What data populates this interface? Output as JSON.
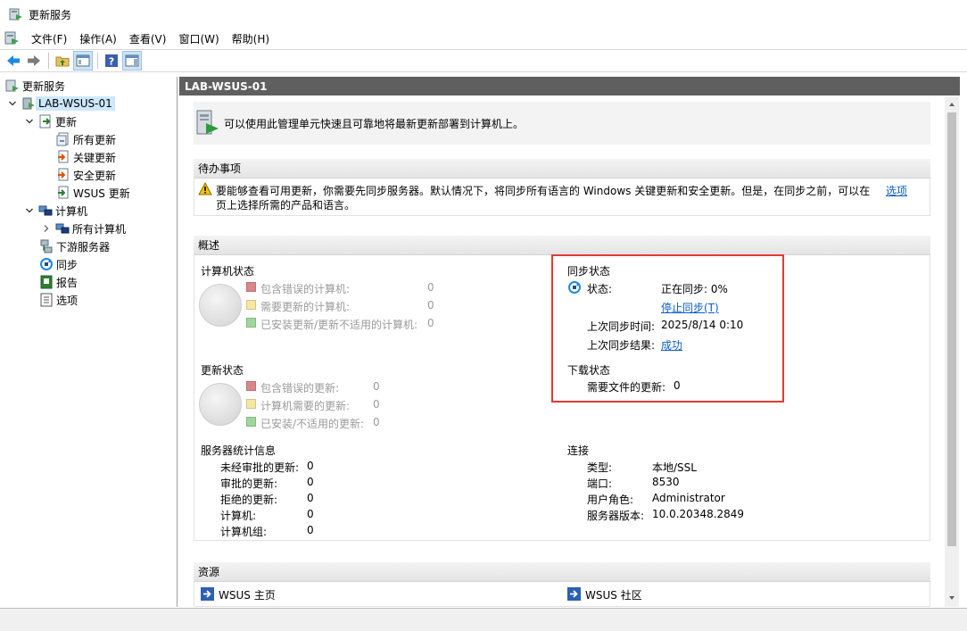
{
  "window": {
    "title": "更新服务"
  },
  "menu": [
    "文件(F)",
    "操作(A)",
    "查看(V)",
    "窗口(W)",
    "帮助(H)"
  ],
  "tree": {
    "root": "更新服务",
    "server": "LAB-WSUS-01",
    "updates": "更新",
    "all_updates": "所有更新",
    "critical_updates": "关键更新",
    "security_updates": "安全更新",
    "wsus_updates": "WSUS 更新",
    "computers": "计算机",
    "all_computers": "所有计算机",
    "downstream": "下游服务器",
    "sync": "同步",
    "reports": "报告",
    "options": "选项"
  },
  "pane": {
    "header": "LAB-WSUS-01",
    "intro": "可以使用此管理单元快速且可靠地将最新更新部署到计算机上。"
  },
  "todo": {
    "title": "待办事项",
    "text1": "要能够查看可用更新，你需要先同步服务器。默认情况下，将同步所有语言的 Windows 关键更新和安全更新。但是，在同步之前，可以在",
    "link": "选项",
    "text2": "页上选择所需的产品和语言。"
  },
  "overview": {
    "title": "概述",
    "computer_status": {
      "title": "计算机状态",
      "rows": [
        {
          "label": "包含错误的计算机:",
          "value": "0",
          "color": "#d9868a"
        },
        {
          "label": "需要更新的计算机:",
          "value": "0",
          "color": "#f6e7a3"
        },
        {
          "label": "已安装更新/更新不适用的计算机:",
          "value": "0",
          "color": "#9fd69b"
        }
      ]
    },
    "update_status": {
      "title": "更新状态",
      "rows": [
        {
          "label": "包含错误的更新:",
          "value": "0",
          "color": "#d9868a"
        },
        {
          "label": "计算机需要的更新:",
          "value": "0",
          "color": "#f6e7a3"
        },
        {
          "label": "已安装/不适用的更新:",
          "value": "0",
          "color": "#9fd69b"
        }
      ]
    },
    "sync_status": {
      "title": "同步状态",
      "status_label": "状态:",
      "status_value": "正在同步: 0%",
      "stop_link": "停止同步(T)",
      "last_sync_label": "上次同步时间:",
      "last_sync_value": "2025/8/14 0:10",
      "last_result_label": "上次同步结果:",
      "last_result_value": "成功"
    },
    "download_status": {
      "title": "下载状态",
      "label": "需要文件的更新:",
      "value": "0"
    },
    "server_stats": {
      "title": "服务器统计信息",
      "rows": [
        {
          "label": "未经审批的更新:",
          "value": "0"
        },
        {
          "label": "审批的更新:",
          "value": "0"
        },
        {
          "label": "拒绝的更新:",
          "value": "0"
        },
        {
          "label": "计算机:",
          "value": "0"
        },
        {
          "label": "计算机组:",
          "value": "0"
        }
      ]
    },
    "connection": {
      "title": "连接",
      "rows": [
        {
          "label": "类型:",
          "value": "本地/SSL"
        },
        {
          "label": "端口:",
          "value": "8530"
        },
        {
          "label": "用户角色:",
          "value": "Administrator"
        },
        {
          "label": "服务器版本:",
          "value": "10.0.20348.2849"
        }
      ]
    }
  },
  "resources": {
    "title": "资源",
    "home": "WSUS 主页",
    "community": "WSUS 社区"
  }
}
